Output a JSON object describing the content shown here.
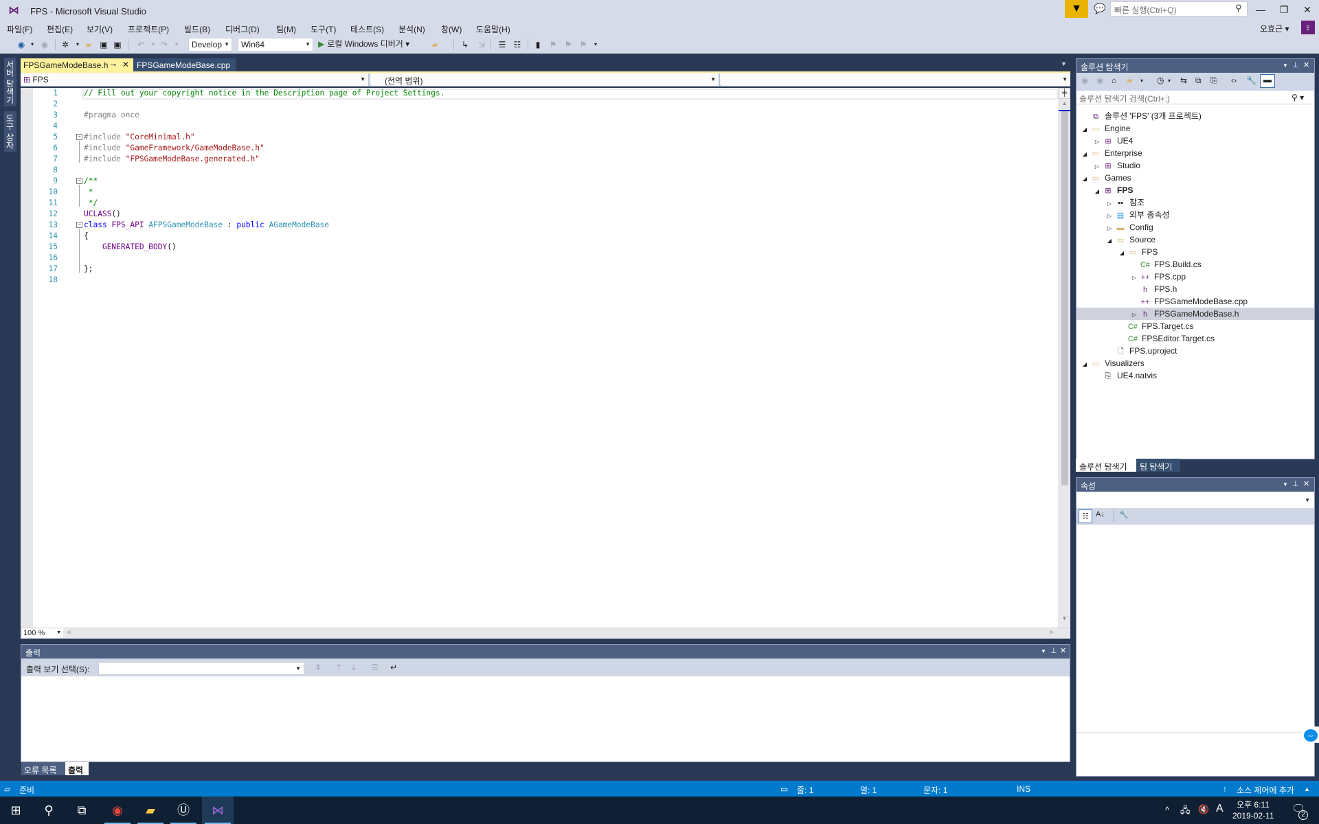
{
  "window": {
    "title": "FPS - Microsoft Visual Studio",
    "quick_launch_placeholder": "빠른 실행(Ctrl+Q)",
    "user_name": "오효근",
    "controls": {
      "minimize": "—",
      "restore": "❐",
      "close": "✕"
    }
  },
  "menu": [
    "파일(F)",
    "편집(E)",
    "보기(V)",
    "프로젝트(P)",
    "빌드(B)",
    "디버그(D)",
    "팀(M)",
    "도구(T)",
    "테스트(S)",
    "분석(N)",
    "창(W)",
    "도움말(H)"
  ],
  "toolbar": {
    "configuration": "Develop",
    "platform": "Win64",
    "run_label": "로컬 Windows 디버거"
  },
  "side_tabs": [
    "서버 탐색기",
    "도구 상자"
  ],
  "editor": {
    "tabs": [
      {
        "label": "FPSGameModeBase.h",
        "active": true
      },
      {
        "label": "FPSGameModeBase.cpp",
        "active": false
      }
    ],
    "nav": {
      "project": "FPS",
      "scope": "(전역 범위)",
      "member": ""
    },
    "zoom": "100 %",
    "lines": [
      {
        "n": "1",
        "tokens": [
          [
            "cm",
            "// Fill out your copyright notice in the Description page of Project Settings."
          ]
        ]
      },
      {
        "n": "2",
        "tokens": []
      },
      {
        "n": "3",
        "tokens": [
          [
            "pp",
            "#pragma once"
          ]
        ]
      },
      {
        "n": "4",
        "tokens": []
      },
      {
        "n": "5",
        "fold": true,
        "tokens": [
          [
            "pp",
            "#include "
          ],
          [
            "str",
            "\"CoreMinimal.h\""
          ]
        ]
      },
      {
        "n": "6",
        "tokens": [
          [
            "pp",
            "#include "
          ],
          [
            "str",
            "\"GameFramework/GameModeBase.h\""
          ]
        ]
      },
      {
        "n": "7",
        "tokens": [
          [
            "pp",
            "#include "
          ],
          [
            "str",
            "\"FPSGameModeBase.generated.h\""
          ]
        ]
      },
      {
        "n": "8",
        "tokens": []
      },
      {
        "n": "9",
        "fold": true,
        "tokens": [
          [
            "cm",
            "/**"
          ]
        ]
      },
      {
        "n": "10",
        "tokens": [
          [
            "cm",
            " *"
          ]
        ]
      },
      {
        "n": "11",
        "tokens": [
          [
            "cm",
            " */"
          ]
        ]
      },
      {
        "n": "12",
        "tokens": [
          [
            "mac",
            "UCLASS"
          ],
          [
            "pl",
            "()"
          ]
        ]
      },
      {
        "n": "13",
        "fold": true,
        "tokens": [
          [
            "kw",
            "class "
          ],
          [
            "mac",
            "FPS_API "
          ],
          [
            "ty",
            "AFPSGameModeBase"
          ],
          [
            "pl",
            " : "
          ],
          [
            "kw",
            "public "
          ],
          [
            "ty",
            "AGameModeBase"
          ]
        ]
      },
      {
        "n": "14",
        "tokens": [
          [
            "pl",
            "{"
          ]
        ]
      },
      {
        "n": "15",
        "tokens": [
          [
            "pl",
            "    "
          ],
          [
            "mac",
            "GENERATED_BODY"
          ],
          [
            "pl",
            "()"
          ]
        ]
      },
      {
        "n": "16",
        "tokens": []
      },
      {
        "n": "17",
        "tokens": [
          [
            "pl",
            "};"
          ]
        ]
      },
      {
        "n": "18",
        "tokens": []
      }
    ]
  },
  "output": {
    "title": "출력",
    "show_from_label": "출력 보기 선택(S):",
    "show_from_value": "",
    "tabs": [
      {
        "label": "오류 목록",
        "active": false
      },
      {
        "label": "출력",
        "active": true
      }
    ]
  },
  "solution_explorer": {
    "title": "솔루션 탐색기",
    "search_placeholder": "솔루션 탐색기 검색(Ctrl+;)",
    "tree": [
      {
        "label": "솔루션 'FPS' (3개 프로젝트)",
        "level": 0,
        "icon": "solution-icon",
        "glyph": "⧉",
        "color": "#68217a",
        "twisty": ""
      },
      {
        "label": "Engine",
        "level": 0,
        "icon": "folder-icon",
        "glyph": "▭",
        "color": "#dcb67a",
        "twisty": "◢"
      },
      {
        "label": "UE4",
        "level": 1,
        "icon": "project-icon",
        "glyph": "⊞",
        "color": "#68217a",
        "twisty": "▷"
      },
      {
        "label": "Enterprise",
        "level": 0,
        "icon": "folder-icon",
        "glyph": "▭",
        "color": "#dcb67a",
        "twisty": "◢"
      },
      {
        "label": "Studio",
        "level": 1,
        "icon": "project-icon",
        "glyph": "⊞",
        "color": "#68217a",
        "twisty": "▷"
      },
      {
        "label": "Games",
        "level": 0,
        "icon": "folder-icon",
        "glyph": "▭",
        "color": "#dcb67a",
        "twisty": "◢"
      },
      {
        "label": "FPS",
        "level": 1,
        "icon": "project-icon",
        "glyph": "⊞",
        "color": "#68217a",
        "twisty": "◢",
        "bold": true
      },
      {
        "label": "참조",
        "level": 2,
        "icon": "references-icon",
        "glyph": "▪▪",
        "color": "#1e1e1e",
        "twisty": "▷"
      },
      {
        "label": "외부 종속성",
        "level": 2,
        "icon": "external-deps-icon",
        "glyph": "▤",
        "color": "#1c97ea",
        "twisty": "▷"
      },
      {
        "label": "Config",
        "level": 2,
        "icon": "filter-folder-icon",
        "glyph": "▬",
        "color": "#dcb67a",
        "twisty": "▷"
      },
      {
        "label": "Source",
        "level": 2,
        "icon": "filter-folder-icon",
        "glyph": "▭",
        "color": "#dcb67a",
        "twisty": "◢"
      },
      {
        "label": "FPS",
        "level": 3,
        "icon": "filter-folder-icon",
        "glyph": "▭",
        "color": "#dcb67a",
        "twisty": "◢"
      },
      {
        "label": "FPS.Build.cs",
        "level": 4,
        "icon": "csharp-file-icon",
        "glyph": "C#",
        "color": "#388a34",
        "twisty": ""
      },
      {
        "label": "FPS.cpp",
        "level": 4,
        "icon": "cpp-file-icon",
        "glyph": "++",
        "color": "#68217a",
        "twisty": "▷"
      },
      {
        "label": "FPS.h",
        "level": 4,
        "icon": "header-file-icon",
        "glyph": "h",
        "color": "#68217a",
        "twisty": ""
      },
      {
        "label": "FPSGameModeBase.cpp",
        "level": 4,
        "icon": "cpp-file-icon",
        "glyph": "++",
        "color": "#68217a",
        "twisty": ""
      },
      {
        "label": "FPSGameModeBase.h",
        "level": 4,
        "icon": "header-file-icon",
        "glyph": "h",
        "color": "#68217a",
        "twisty": "▷",
        "selected": true
      },
      {
        "label": "FPS.Target.cs",
        "level": 3,
        "icon": "csharp-file-icon",
        "glyph": "C#",
        "color": "#388a34",
        "twisty": ""
      },
      {
        "label": "FPSEditor.Target.cs",
        "level": 3,
        "icon": "csharp-file-icon",
        "glyph": "C#",
        "color": "#388a34",
        "twisty": ""
      },
      {
        "label": "FPS.uproject",
        "level": 2,
        "icon": "file-icon",
        "glyph": "🗋",
        "color": "#1e1e1e",
        "twisty": ""
      },
      {
        "label": "Visualizers",
        "level": 0,
        "icon": "folder-icon",
        "glyph": "▭",
        "color": "#dcb67a",
        "twisty": "◢"
      },
      {
        "label": "UE4.natvis",
        "level": 1,
        "icon": "natvis-file-icon",
        "glyph": "⎘",
        "color": "#1e1e1e",
        "twisty": ""
      }
    ],
    "bottom_tabs": [
      {
        "label": "솔루션 탐색기",
        "active": true
      },
      {
        "label": "팀 탐색기",
        "active": false
      }
    ]
  },
  "properties": {
    "title": "속성"
  },
  "statusbar": {
    "ready": "준비",
    "line": "줄: 1",
    "col": "열: 1",
    "char": "문자: 1",
    "mode": "INS",
    "source_control": "소스 제어에 추가"
  },
  "taskbar": {
    "time": "오후 6:11",
    "date": "2019-02-11",
    "ime": "A",
    "notifications": "2"
  },
  "colors": {
    "accent": "#007acc",
    "vs_purple": "#68217a",
    "active_tab": "#fff29d",
    "panel_header": "#4d6082",
    "chrome": "#d6dbe9",
    "dark_bg": "#293955"
  }
}
